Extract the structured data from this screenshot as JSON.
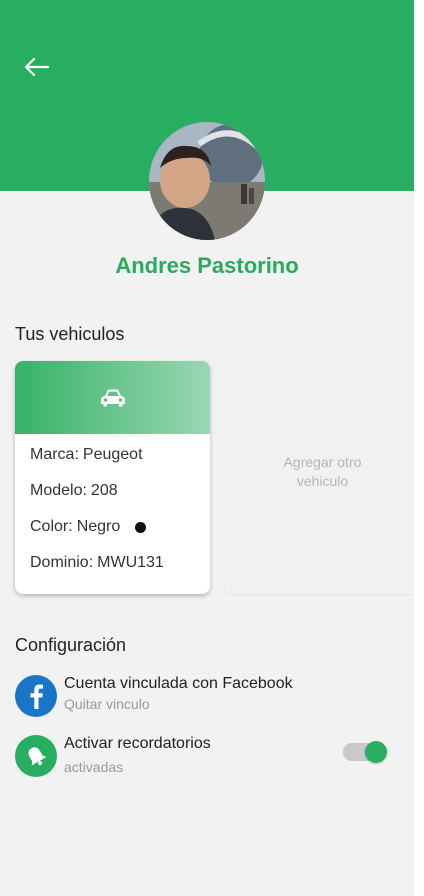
{
  "header": {
    "back_icon": "arrow-left-icon",
    "color": "#27ae60"
  },
  "profile": {
    "name": "Andres Pastorino",
    "name_color": "#2aaa5a"
  },
  "vehicles": {
    "section_title": "Tus vehiculos",
    "card_icon": "car-icon",
    "items": [
      {
        "brand_label": "Marca:",
        "brand": "Peugeot"
      },
      {
        "model_label": "Modelo:",
        "model": "208"
      },
      {
        "color_label": "Color:",
        "color": "Negro",
        "swatch": "#111111"
      },
      {
        "plate_label": "Dominio:",
        "plate": "MWU131"
      }
    ],
    "add_label": "Agregar otro vehiculo"
  },
  "settings": {
    "section_title": "Configuración",
    "facebook": {
      "icon": "facebook-icon",
      "title": "Cuenta vinculada con Facebook",
      "subtitle": "Quitar vinculo",
      "icon_color": "#1976c7"
    },
    "reminders": {
      "icon": "bell-icon",
      "title": "Activar recordatorios",
      "subtitle": "activadas",
      "enabled": true,
      "icon_color": "#27ae60"
    }
  }
}
